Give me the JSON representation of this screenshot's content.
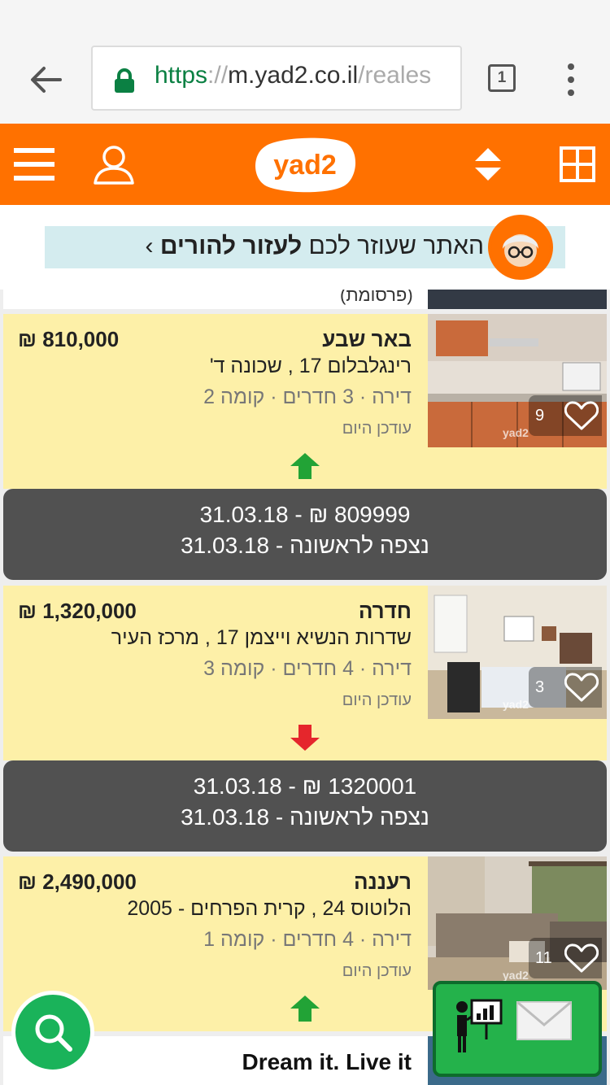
{
  "browser": {
    "url_scheme": "https",
    "url_sep": "://",
    "url_host": "m.yad2.co.il",
    "url_path": "/reales",
    "tab_count": "1"
  },
  "header": {
    "logo_text": "yad2",
    "accent": "#ff7100"
  },
  "ad": {
    "text_regular": "האתר שעוזר לכם ",
    "text_bold": "לעזור להורים",
    "chevron": "›"
  },
  "promo_prev": {
    "label": "(פרסומת)"
  },
  "listings": [
    {
      "city": "באר שבע",
      "price": "810,000 ₪",
      "address": "רינגלבלום 17 , שכונה ד'",
      "details": "דירה · 3 חדרים · קומה 2",
      "updated": "עודכן היום",
      "likes": "9",
      "trend": "up",
      "history_price": "809999 ₪ - 31.03.18",
      "history_first_seen": "נצפה לראשונה - 31.03.18"
    },
    {
      "city": "חדרה",
      "price": "1,320,000 ₪",
      "address": "שדרות הנשיא וייצמן 17 , מרכז העיר",
      "details": "דירה · 4 חדרים · קומה 3",
      "updated": "עודכן היום",
      "likes": "3",
      "trend": "down",
      "history_price": "1320001 ₪ - 31.03.18",
      "history_first_seen": "נצפה לראשונה - 31.03.18"
    },
    {
      "city": "רעננה",
      "price": "2,490,000 ₪",
      "address": "הלוטוס 24 , קרית הפרחים - 2005",
      "details": "דירה · 4 חדרים · קומה 1",
      "updated": "עודכן היום",
      "likes": "11",
      "trend": "up"
    }
  ],
  "promo_next": {
    "title": "Dream it. Live it"
  },
  "watermark": "yad2"
}
